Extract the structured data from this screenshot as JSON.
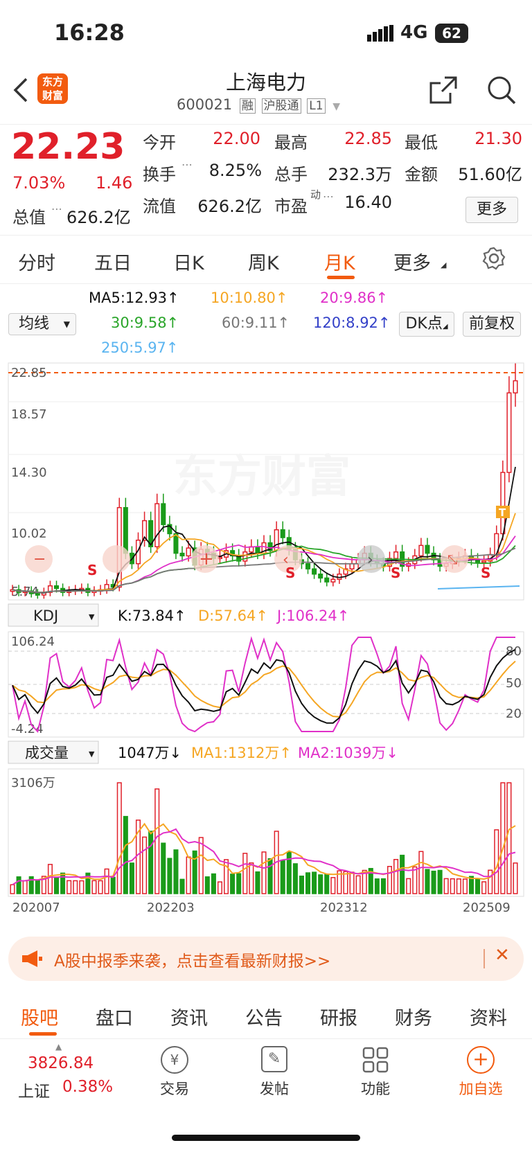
{
  "status_bar": {
    "time": "16:28",
    "network": "4G",
    "battery": "62"
  },
  "header": {
    "title": "上海电力",
    "code": "600021",
    "tags": [
      "融",
      "沪股通",
      "L1"
    ],
    "logo_text": "东方财富"
  },
  "quote": {
    "price": "22.23",
    "change_pct": "7.03%",
    "change": "1.46",
    "open_label": "今开",
    "open": "22.00",
    "high_label": "最高",
    "high": "22.85",
    "low_label": "最低",
    "low": "21.30",
    "turnover_label": "换手",
    "turnover": "8.25%",
    "volume_label": "总手",
    "volume": "232.3万",
    "amount_label": "金额",
    "amount": "51.60亿",
    "mcap_label": "总值",
    "mcap": "626.2亿",
    "float_label": "流值",
    "float_cap": "626.2亿",
    "pe_label": "市盈",
    "pe_sup": "动",
    "pe": "16.40",
    "more_label": "更多"
  },
  "period_tabs": [
    {
      "label": "分时"
    },
    {
      "label": "五日"
    },
    {
      "label": "日K"
    },
    {
      "label": "周K"
    },
    {
      "label": "月K",
      "active": true
    },
    {
      "label": "更多"
    }
  ],
  "ma_legend": {
    "selector": "均线",
    "ma5": "MA5:12.93↑",
    "ma10": "10:10.80↑",
    "ma20": "20:9.86↑",
    "ma30": "30:9.58↑",
    "ma60": "60:9.11↑",
    "ma120": "120:8.92↑",
    "ma250": "250:5.97↑",
    "dk_label": "DK点",
    "fq_label": "前复权"
  },
  "colors": {
    "up": "#e0202a",
    "down": "#1a9b1a",
    "accent": "#f25b0f",
    "ma5": "#111111",
    "ma10": "#f5a623",
    "ma20": "#e030c8",
    "ma30": "#2aa52a",
    "ma60": "#777777",
    "ma120": "#3340c8",
    "ma250": "#5ab4f0"
  },
  "main_chart": {
    "y_ticks": [
      "22.85",
      "18.57",
      "14.30",
      "10.02",
      "5.74"
    ],
    "watermark": "东方财富",
    "signals": [
      "S",
      "S",
      "S",
      "S",
      "S",
      "T"
    ]
  },
  "kdj": {
    "selector": "KDJ",
    "k": "K:73.84↑",
    "d": "D:57.64↑",
    "j": "J:106.24↑",
    "y_max": "106.24",
    "y_min": "-4.24",
    "levels": [
      "80",
      "50",
      "20"
    ]
  },
  "volume": {
    "selector": "成交量",
    "value": "1047万↓",
    "ma1": "MA1:1312万↑",
    "ma2": "MA2:1039万↓",
    "y_max": "3106万"
  },
  "x_labels": [
    "202007",
    "202203",
    "202312",
    "202509"
  ],
  "banner": {
    "text": "A股中报季来袭，点击查看最新财报>>"
  },
  "sub_tabs": [
    {
      "label": "股吧",
      "active": true
    },
    {
      "label": "盘口"
    },
    {
      "label": "资讯"
    },
    {
      "label": "公告"
    },
    {
      "label": "研报"
    },
    {
      "label": "财务"
    },
    {
      "label": "资料"
    }
  ],
  "bottom_bar": {
    "index_value": "3826.84",
    "index_name": "上证",
    "index_change": "0.38%",
    "items": [
      {
        "label": "交易",
        "icon": "yen-refresh-icon"
      },
      {
        "label": "发帖",
        "icon": "edit-icon"
      },
      {
        "label": "功能",
        "icon": "grid-icon"
      },
      {
        "label": "加自选",
        "icon": "plus-circle-icon"
      }
    ]
  },
  "chart_data": {
    "type": "candlestick",
    "candles_close": [
      6.2,
      6.0,
      6.1,
      5.9,
      5.8,
      6.0,
      6.5,
      6.3,
      6.0,
      6.1,
      6.2,
      6.3,
      6.0,
      6.1,
      6.2,
      6.6,
      6.4,
      12.5,
      9.0,
      8.2,
      10.0,
      11.5,
      9.5,
      12.8,
      11.2,
      10.5,
      9.0,
      8.8,
      9.4,
      8.1,
      9.3,
      9.0,
      8.6,
      8.7,
      9.2,
      8.8,
      8.4,
      9.1,
      9.5,
      9.0,
      9.8,
      9.2,
      10.8,
      10.2,
      9.3,
      8.5,
      8.2,
      7.8,
      7.4,
      7.1,
      6.8,
      7.0,
      7.4,
      7.8,
      8.2,
      8.5,
      9.0,
      8.4,
      8.2,
      8.0,
      8.6,
      9.1,
      8.0,
      8.2,
      8.8,
      9.6,
      9.0,
      8.5,
      8.0,
      8.2,
      8.4,
      8.6,
      8.8,
      8.5,
      8.3,
      8.4,
      8.9,
      10.5,
      15.2,
      21.3,
      22.23
    ],
    "ylim": [
      5.74,
      22.85
    ]
  }
}
